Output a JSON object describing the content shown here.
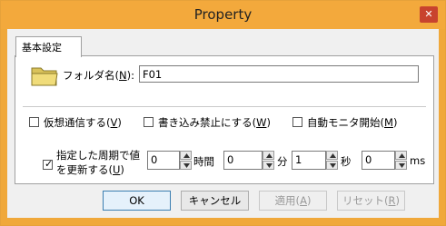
{
  "window": {
    "title": "Property",
    "close_label": "✕"
  },
  "tabs": [
    {
      "label": "基本設定"
    }
  ],
  "folder": {
    "label_prefix": "フォルダ名(",
    "label_key": "N",
    "label_suffix": "):",
    "value": "F01",
    "icon": "folder-icon"
  },
  "options": [
    {
      "prefix": "仮想通信する(",
      "key": "V",
      "suffix": ")",
      "checked": false
    },
    {
      "prefix": "書き込み禁止にする(",
      "key": "W",
      "suffix": ")",
      "checked": false
    },
    {
      "prefix": "自動モニタ開始(",
      "key": "M",
      "suffix": ")",
      "checked": false
    }
  ],
  "periodic": {
    "line1": "指定した周期で値",
    "line2_prefix": "を更新する(",
    "key": "U",
    "line2_suffix": ")",
    "checked": true,
    "fields": [
      {
        "value": "0",
        "unit": "時間"
      },
      {
        "value": "0",
        "unit": "分"
      },
      {
        "value": "1",
        "unit": "秒"
      },
      {
        "value": "0",
        "unit": "ms"
      }
    ]
  },
  "buttons": {
    "ok": "OK",
    "cancel": "キャンセル",
    "apply_prefix": "適用(",
    "apply_key": "A",
    "apply_suffix": ")",
    "reset_prefix": "リセット(",
    "reset_key": "R",
    "reset_suffix": ")"
  }
}
